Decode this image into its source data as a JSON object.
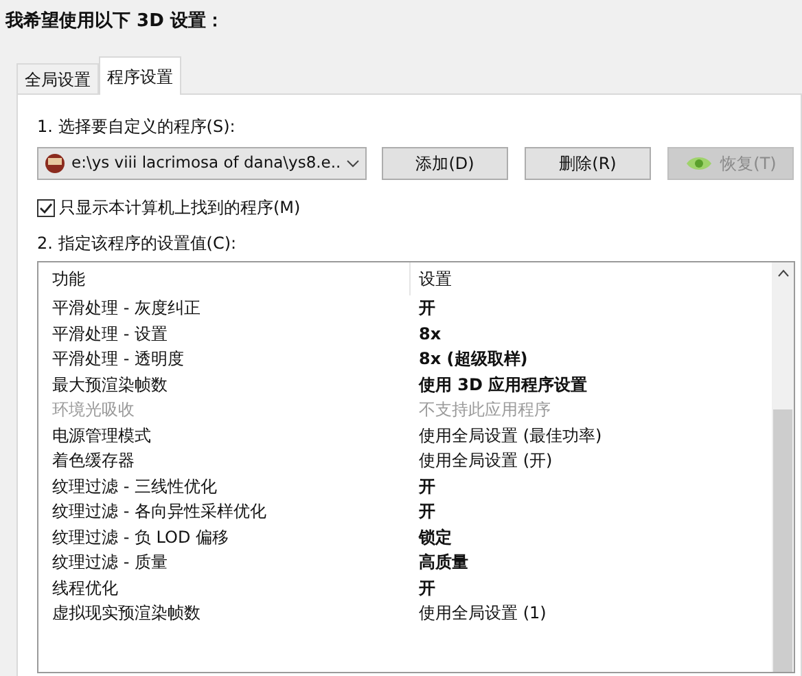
{
  "heading": "我希望使用以下 3D 设置：",
  "tabs": [
    {
      "label": "全局设置",
      "selected": false
    },
    {
      "label": "程序设置",
      "selected": true
    }
  ],
  "step1_label": "1. 选择要自定义的程序(S):",
  "program_dropdown": {
    "value": "e:\\ys viii lacrimosa of dana\\ys8.e..."
  },
  "buttons": [
    {
      "label": "添加(D)",
      "disabled": false,
      "kind": "plain"
    },
    {
      "label": "删除(R)",
      "disabled": false,
      "kind": "plain"
    },
    {
      "label": "恢复(T)",
      "disabled": true,
      "kind": "logo"
    }
  ],
  "filter_checkbox": {
    "label": "只显示本计算机上找到的程序(M)",
    "checked": true
  },
  "step2_label": "2. 指定该程序的设置值(C):",
  "table": {
    "columns": [
      "功能",
      "设置"
    ],
    "rows": [
      {
        "feature": "平滑处理 - 灰度纠正",
        "setting": "开",
        "modified": true,
        "disabled": false
      },
      {
        "feature": "平滑处理 - 设置",
        "setting": "8x",
        "modified": true,
        "disabled": false
      },
      {
        "feature": "平滑处理 - 透明度",
        "setting": "8x (超级取样)",
        "modified": true,
        "disabled": false
      },
      {
        "feature": "最大预渲染帧数",
        "setting": "使用 3D 应用程序设置",
        "modified": true,
        "disabled": false
      },
      {
        "feature": "环境光吸收",
        "setting": "不支持此应用程序",
        "modified": false,
        "disabled": true
      },
      {
        "feature": "电源管理模式",
        "setting": "使用全局设置 (最佳功率)",
        "modified": false,
        "disabled": false
      },
      {
        "feature": "着色缓存器",
        "setting": "使用全局设置 (开)",
        "modified": false,
        "disabled": false
      },
      {
        "feature": "纹理过滤 - 三线性优化",
        "setting": "开",
        "modified": true,
        "disabled": false
      },
      {
        "feature": "纹理过滤 - 各向异性采样优化",
        "setting": "开",
        "modified": true,
        "disabled": false
      },
      {
        "feature": "纹理过滤 - 负 LOD 偏移",
        "setting": "锁定",
        "modified": true,
        "disabled": false
      },
      {
        "feature": "纹理过滤 - 质量",
        "setting": "高质量",
        "modified": true,
        "disabled": false
      },
      {
        "feature": "线程优化",
        "setting": "开",
        "modified": true,
        "disabled": false
      },
      {
        "feature": "虚拟现实预渲染帧数",
        "setting": "使用全局设置 (1)",
        "modified": false,
        "disabled": false
      }
    ]
  }
}
